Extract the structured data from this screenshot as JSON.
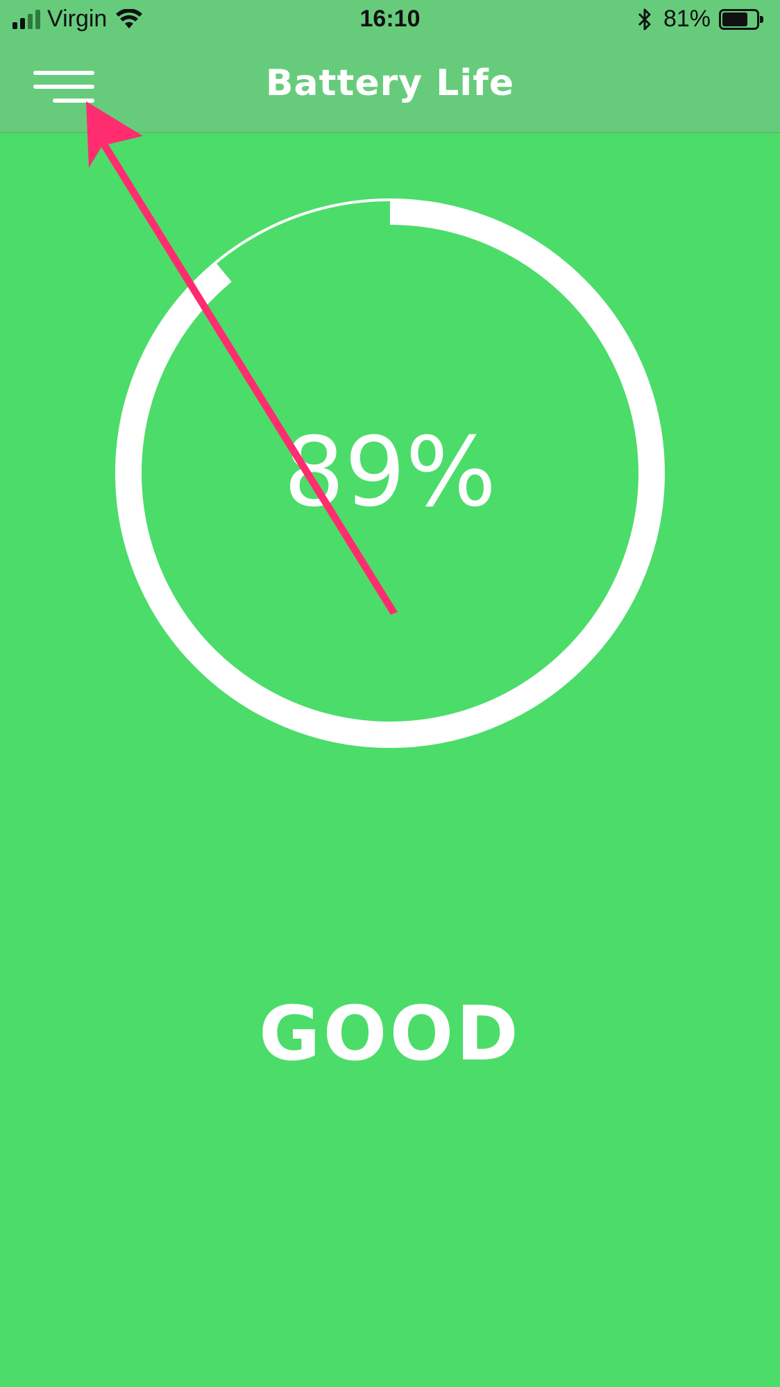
{
  "status_bar": {
    "carrier": "Virgin",
    "time": "16:10",
    "battery_percent": "81%",
    "battery_level": 0.81,
    "signal_bars": 4,
    "signal_active": 2
  },
  "header": {
    "title": "Battery Life",
    "menu_icon": "hamburger-menu-icon"
  },
  "gauge": {
    "percent_label": "89%",
    "percent_value": 89
  },
  "condition": "GOOD",
  "colors": {
    "background": "#4cdc6a",
    "header": "#66cc7c",
    "ring": "#ffffff",
    "annotation_arrow": "#ff2d6f"
  }
}
